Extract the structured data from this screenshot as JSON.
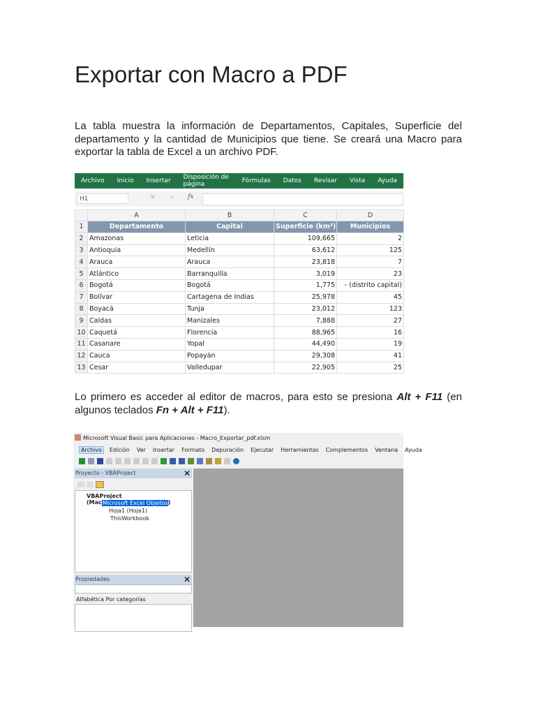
{
  "title": "Exportar con Macro a PDF",
  "para1": "La tabla muestra la información de Departamentos, Capitales, Superficie del departamento y la cantidad de Municipios que tiene. Se creará una Macro para exportar la tabla de Excel a un archivo PDF.",
  "para2": {
    "a": "Lo primero es acceder al editor de macros, para esto se presiona ",
    "k1": "Alt + F11",
    "b": " (en algunos teclados ",
    "k2": "Fn + Alt + F11",
    "c": ")."
  },
  "excel": {
    "ribbon": [
      "Archivo",
      "Inicio",
      "Insertar",
      "Disposición de página",
      "Fórmulas",
      "Datos",
      "Revisar",
      "Vista",
      "Ayuda"
    ],
    "namebox": "H1",
    "fx": "fx",
    "cols": [
      "A",
      "B",
      "C",
      "D"
    ],
    "headers": [
      "Departamento",
      "Capital",
      "Superficie (km²)",
      "Municipios"
    ],
    "rows": [
      [
        "Amazonas",
        "Leticia",
        "109,665",
        "2"
      ],
      [
        "Antioquia",
        "Medellín",
        "63,612",
        "125"
      ],
      [
        "Arauca",
        "Arauca",
        "23,818",
        "7"
      ],
      [
        "Atlántico",
        "Barranquilla",
        "3,019",
        "23"
      ],
      [
        "Bogotá",
        "Bogotá",
        "1,775",
        "- (distrito capital)"
      ],
      [
        "Bolívar",
        "Cartagena de Indias",
        "25,978",
        "45"
      ],
      [
        "Boyacá",
        "Tunja",
        "23,012",
        "123"
      ],
      [
        "Caldas",
        "Manizales",
        "7,888",
        "27"
      ],
      [
        "Caquetá",
        "Florencia",
        "88,965",
        "16"
      ],
      [
        "Casanare",
        "Yopal",
        "44,490",
        "19"
      ],
      [
        "Cauca",
        "Popayán",
        "29,308",
        "41"
      ],
      [
        "Cesar",
        "Valledupar",
        "22,905",
        "25"
      ]
    ]
  },
  "vba": {
    "title": "Microsoft Visual Basic para Aplicaciones - Macro_Exportar_pdf.xlsm",
    "menu": [
      "Archivo",
      "Edición",
      "Ver",
      "Insertar",
      "Formato",
      "Depuración",
      "Ejecutar",
      "Herramientas",
      "Complementos",
      "Ventana",
      "Ayuda"
    ],
    "project_title": "Proyecto - VBAProject",
    "tree": [
      "VBAProject (Macro_Exportar_pdf.xlsm)",
      "Microsoft Excel Objetos",
      "Hoja1 (Hoja1)",
      "ThisWorkbook"
    ],
    "props_title": "Propiedades",
    "tabs": [
      "Alfabética",
      "Por categorías"
    ]
  }
}
